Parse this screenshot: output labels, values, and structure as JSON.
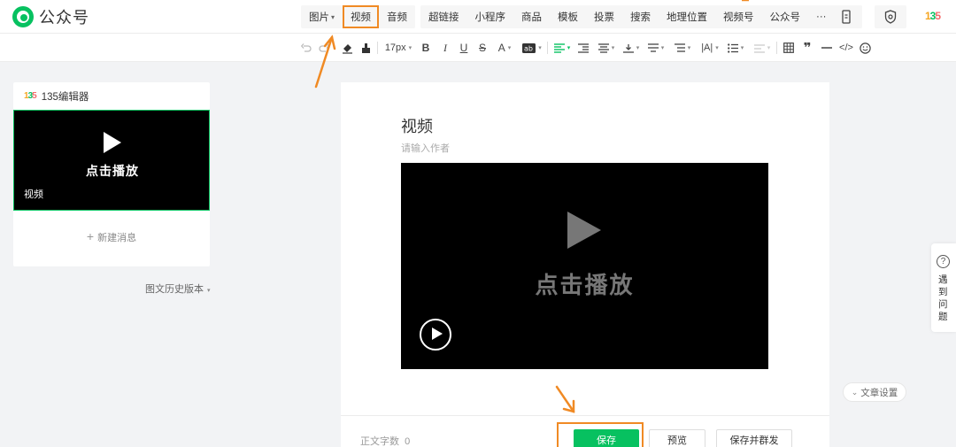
{
  "app": {
    "name": "公众号"
  },
  "insert_tools_1": [
    {
      "label": "图片",
      "caret": "▾"
    },
    {
      "label": "视频"
    },
    {
      "label": "音频"
    }
  ],
  "insert_tools_2": [
    {
      "label": "超链接"
    },
    {
      "label": "小程序"
    },
    {
      "label": "商品"
    },
    {
      "label": "模板"
    },
    {
      "label": "投票"
    },
    {
      "label": "搜索"
    },
    {
      "label": "地理位置"
    },
    {
      "label": "视频号"
    },
    {
      "label": "公众号"
    },
    {
      "label": "···"
    }
  ],
  "format_toolbar": {
    "font_size": "17px"
  },
  "plugin": {
    "logo": "135",
    "name": "135编辑器"
  },
  "article_list": {
    "thumb_play_text": "点击播放",
    "thumb_title": "视频",
    "new_message": "新建消息",
    "history_version": "图文历史版本"
  },
  "editor": {
    "title": "视频",
    "author_placeholder": "请输入作者",
    "video_play_text": "点击播放"
  },
  "bottom_bar": {
    "word_count_label": "正文字数",
    "word_count": "0",
    "save": "保存",
    "preview": "预览",
    "save_and_send": "保存并群发"
  },
  "side": {
    "help_chars": [
      "遇",
      "到",
      "问",
      "题"
    ],
    "article_settings": "文章设置"
  },
  "colors": {
    "brand": "#07c160",
    "annotation": "#f08a24"
  }
}
